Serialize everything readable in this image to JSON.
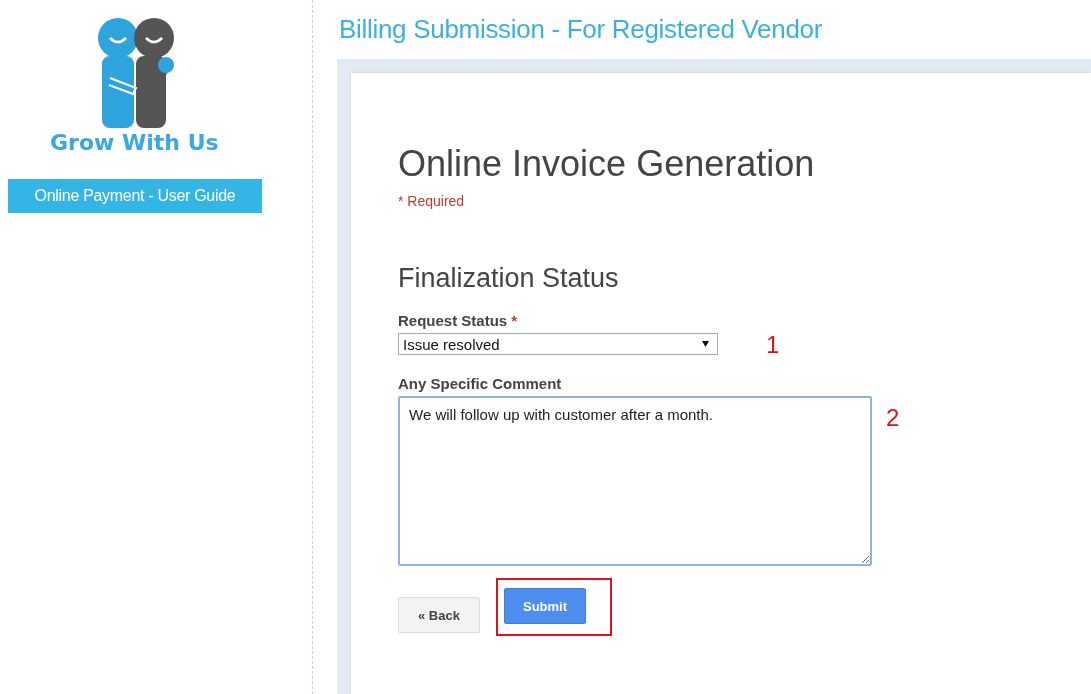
{
  "sidebar": {
    "logo_text": "Grow With Us",
    "guide_button": "Online Payment - User Guide"
  },
  "page_title": "Billing Submission - For Registered Vendor",
  "form": {
    "title": "Online Invoice Generation",
    "required_note": "* Required",
    "section": "Finalization Status",
    "fields": [
      {
        "kind": "select",
        "label": "Request Status",
        "required_mark": "*",
        "value": "Issue resolved",
        "annotation": "1"
      },
      {
        "kind": "textarea",
        "label": "Any Specific Comment",
        "value": "We will follow up with customer after a month.",
        "annotation": "2"
      }
    ],
    "buttons": [
      {
        "label": "« Back",
        "kind": "back",
        "highlighted": false
      },
      {
        "label": "Submit",
        "kind": "submit",
        "highlighted": true
      }
    ]
  }
}
